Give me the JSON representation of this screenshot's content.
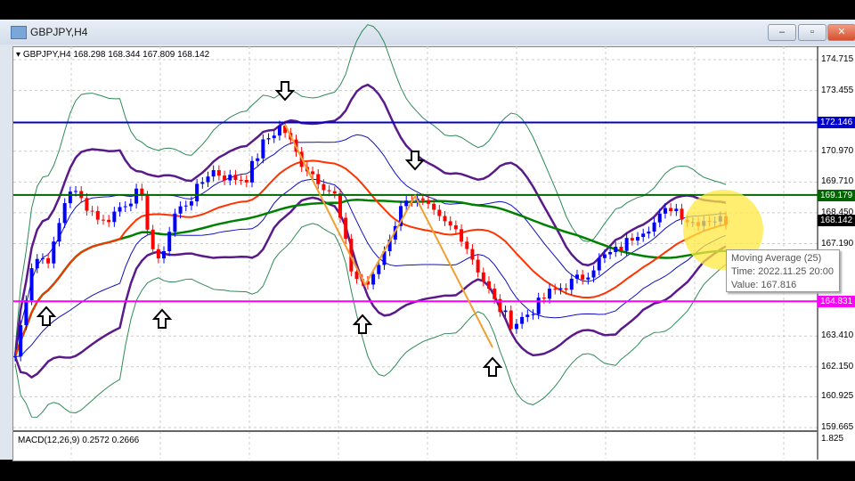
{
  "window": {
    "title": "GBPJPY,H4",
    "buttons": {
      "minimize": "‒",
      "maximize": "▫",
      "close": "✕"
    }
  },
  "chart_header": "GBPJPY,H4  168.298 168.344 167.809 168.142",
  "macd_label": "MACD(12,26,9) 0.2572 0.2666",
  "macd_axis_value": "1.825",
  "tooltip": {
    "title": "Moving Average (25)",
    "time": "Time: 2022.11.25 20:00",
    "value": "Value: 167.816"
  },
  "chart_data": {
    "type": "candlestick",
    "symbol": "GBPJPY",
    "timeframe": "H4",
    "ylim": [
      159.665,
      174.715
    ],
    "y_ticks": [
      "174.715",
      "173.455",
      "170.970",
      "169.710",
      "168.450",
      "167.190",
      "163.410",
      "162.150",
      "160.925",
      "159.665"
    ],
    "close_path": [
      162.58,
      166.59,
      166.59,
      169.5,
      168.77,
      168.05,
      168.77,
      169.32,
      166.22,
      168.41,
      169.14,
      170.23,
      169.87,
      169.87,
      171.33,
      172.05,
      170.6,
      169.87,
      169.14,
      165.86,
      165.49,
      167.32,
      169.14,
      168.77,
      168.05,
      167.68,
      166.22,
      164.77,
      163.86,
      164.4,
      165.13,
      165.49,
      165.86,
      166.59,
      166.95,
      167.68,
      168.05,
      168.77,
      168.05,
      168.23,
      168.14
    ],
    "levels": [
      {
        "value": "172.146",
        "color": "#0000cc"
      },
      {
        "value": "169.179",
        "color": "#006400"
      },
      {
        "value": "164.831",
        "color": "#ff00ff"
      }
    ],
    "current_price": "168.142",
    "indicators": [
      "Moving Average (25)",
      "Bollinger Bands",
      "MACD(12,26,9)"
    ],
    "colors": {
      "up": "#0000ff",
      "down": "#ff0000",
      "ma_short": "#ff3300",
      "ma_long": "#008000",
      "band": "#2e8b57",
      "envelope": "#5a1a8a",
      "zigzag": "#f0a030",
      "highlight": "#ffe840"
    }
  },
  "annotations": {
    "down_arrows": 2,
    "up_arrows": 4
  }
}
